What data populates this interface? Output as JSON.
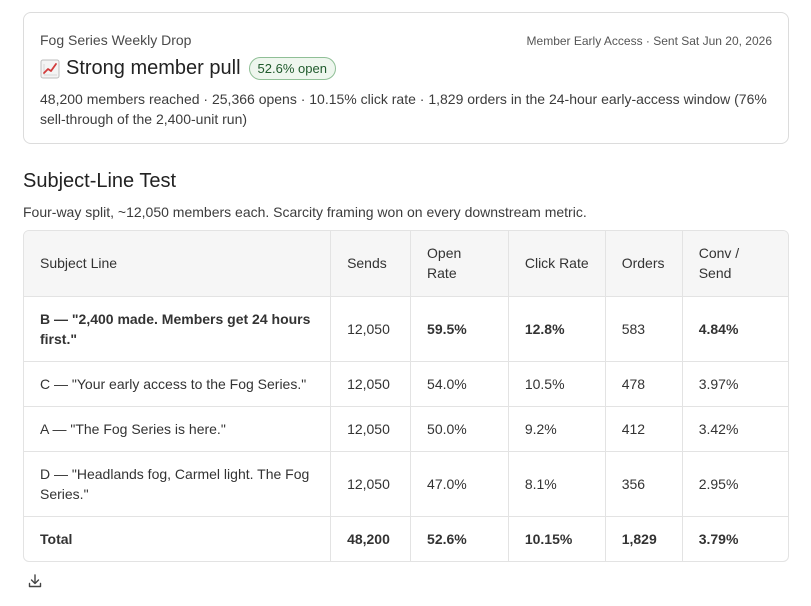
{
  "card": {
    "eyebrow": "Fog Series Weekly Drop",
    "meta": "Member Early Access · Sent Sat Jun 20, 2026",
    "icon": "chart-increasing-icon",
    "headline": "Strong member pull",
    "badge": "52.6% open",
    "description": "48,200 members reached · 25,366 opens · 10.15% click rate · 1,829 orders in the 24-hour early-access window (76% sell-through of the 2,400-unit run)"
  },
  "section": {
    "title": "Subject-Line Test",
    "subtitle": "Four-way split, ~12,050 members each. Scarcity framing won on every downstream metric."
  },
  "table": {
    "headers": [
      "Subject Line",
      "Sends",
      "Open Rate",
      "Click Rate",
      "Orders",
      "Conv / Send"
    ],
    "rows": [
      [
        "B — \"2,400 made. Members get 24 hours first.\"",
        "12,050",
        "59.5%",
        "12.8%",
        "583",
        "4.84%"
      ],
      [
        "C — \"Your early access to the Fog Series.\"",
        "12,050",
        "54.0%",
        "10.5%",
        "478",
        "3.97%"
      ],
      [
        "A — \"The Fog Series is here.\"",
        "12,050",
        "50.0%",
        "9.2%",
        "412",
        "3.42%"
      ],
      [
        "D — \"Headlands fog, Carmel light. The Fog Series.\"",
        "12,050",
        "47.0%",
        "8.1%",
        "356",
        "2.95%"
      ],
      [
        "Total",
        "48,200",
        "52.6%",
        "10.15%",
        "1,829",
        "3.79%"
      ]
    ]
  },
  "footer": {
    "icon": "download-icon"
  },
  "colors": {
    "badge_text": "#1f5a2c",
    "badge_bg": "#eef6ee",
    "badge_border": "#8fbf96"
  }
}
